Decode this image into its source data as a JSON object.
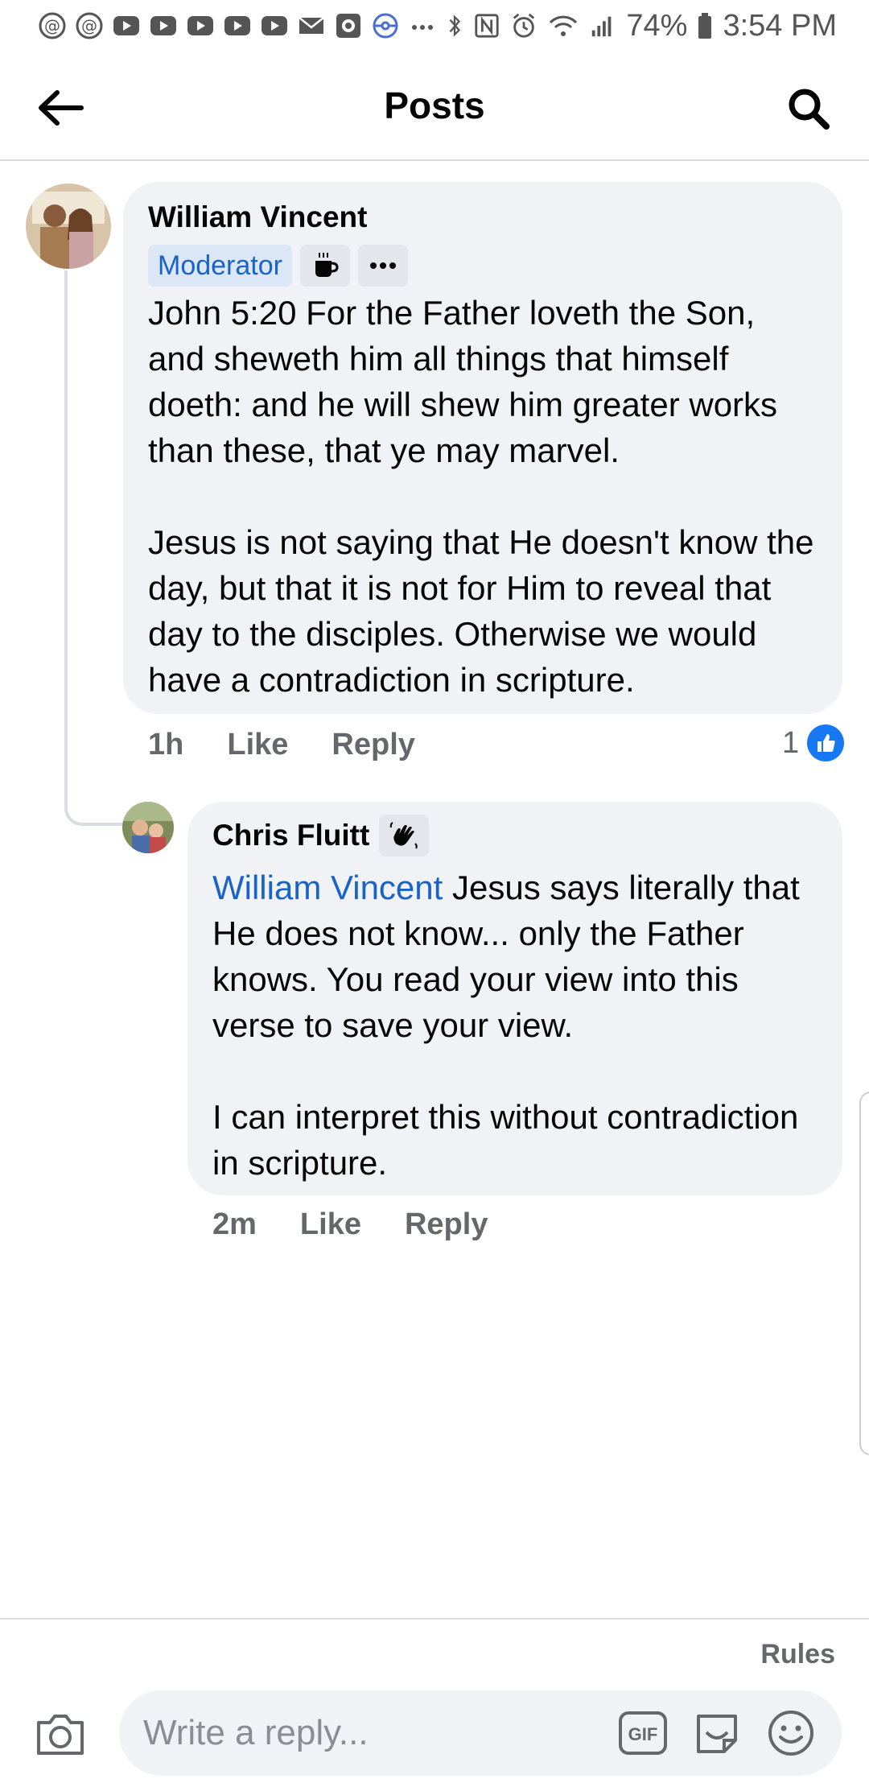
{
  "status_bar": {
    "battery": "74%",
    "time": "3:54 PM",
    "icons": [
      "threads-icon",
      "threads-icon",
      "youtube-icon",
      "youtube-icon",
      "youtube-icon",
      "youtube-icon",
      "youtube-icon",
      "mail-icon",
      "photo-icon",
      "pokeball-icon",
      "more-dots-icon",
      "bluetooth-icon",
      "nfc-icon",
      "alarm-icon",
      "wifi-icon",
      "signal-icon",
      "battery-icon"
    ]
  },
  "header": {
    "title": "Posts",
    "back_icon": "arrow-left-icon",
    "search_icon": "search-icon"
  },
  "comments": [
    {
      "author": "William Vincent",
      "badges": {
        "role": "Moderator",
        "icon1": "coffee-icon",
        "icon2": "more-dots-icon"
      },
      "text": "John 5:20 For the Father loveth the Son, and sheweth him all things that himself doeth: and he will shew him greater works than these, that ye may marvel.\n\nJesus is not saying that He doesn't know the day, but that it is not for Him to reveal that day to the disciples. Otherwise we would have a contradiction in scripture.",
      "time": "1h",
      "like_label": "Like",
      "reply_label": "Reply",
      "reaction_count": "1",
      "reaction_icon": "thumbs-up-icon"
    },
    {
      "author": "Chris Fluitt",
      "author_badge_icon": "waving-hand-icon",
      "mention": "William Vincent",
      "text": " Jesus says literally that He does not know... only the Father knows. You read your view into this verse to save your view.\n\nI can interpret this without contradiction in scripture.",
      "time": "2m",
      "like_label": "Like",
      "reply_label": "Reply"
    }
  ],
  "footer": {
    "rules_label": "Rules",
    "reply_placeholder": "Write a reply...",
    "gif_label": "GIF",
    "icons": [
      "camera-icon",
      "gif-icon",
      "sticker-icon",
      "emoji-icon"
    ]
  },
  "colors": {
    "accent_blue": "#1877f2",
    "mention_blue": "#1a63c6",
    "bubble_bg": "#f0f2f5",
    "secondary_text": "#65676b"
  }
}
